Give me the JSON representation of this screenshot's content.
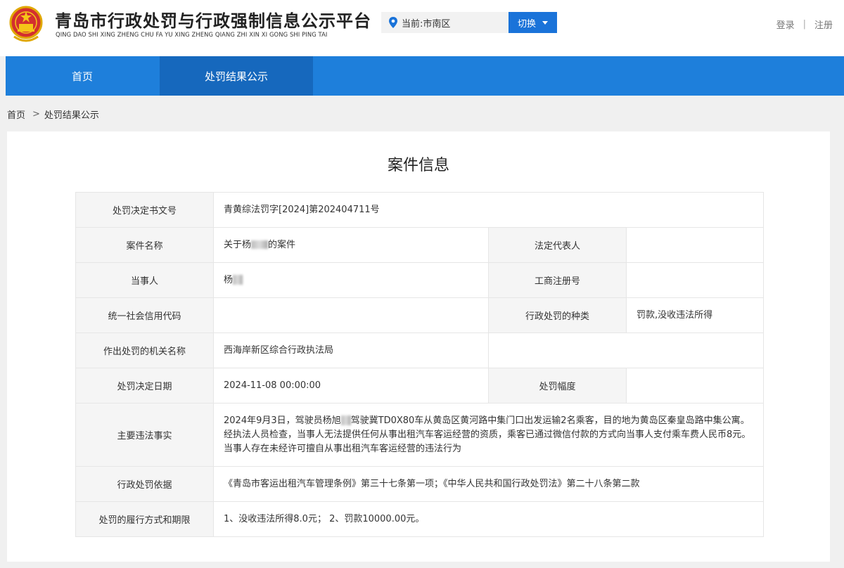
{
  "header": {
    "title": "青岛市行政处罚与行政强制信息公示平台",
    "pinyin": "QING DAO SHI XING ZHENG CHU FA YU XING ZHENG QIANG ZHI XIN XI GONG SHI PING TAI",
    "location_label": "当前:市南区",
    "switch_label": "切换",
    "login": "登录",
    "separator": "|",
    "register": "注册"
  },
  "nav": {
    "home": "首页",
    "results": "处罚结果公示"
  },
  "breadcrumb": {
    "home": "首页",
    "separator": ">",
    "current": "处罚结果公示"
  },
  "card": {
    "title": "案件信息",
    "rows": {
      "decision_no_label": "处罚决定书文号",
      "decision_no": "青黄综法罚字[2024]第202404711号",
      "case_name_label": "案件名称",
      "case_name_prefix": "关于杨",
      "case_name_suffix": "的案件",
      "legal_rep_label": "法定代表人",
      "legal_rep": "",
      "party_label": "当事人",
      "party": "杨",
      "reg_no_label": "工商注册号",
      "reg_no": "",
      "credit_code_label": "统一社会信用代码",
      "credit_code": "",
      "penalty_type_label": "行政处罚的种类",
      "penalty_type": "罚款,没收违法所得",
      "authority_label": "作出处罚的机关名称",
      "authority": "西海岸新区综合行政执法局",
      "date_label": "处罚决定日期",
      "date": "2024-11-08 00:00:00",
      "range_label": "处罚幅度",
      "range": "",
      "facts_label": "主要违法事实",
      "facts_part1": "2024年9月3日，驾驶员杨旭",
      "facts_part2": "驾驶冀TD0X80车从黄岛区黄河路中集门口出发运输2名乘客，目的地为黄岛区秦皇岛路中集公寓。经执法人员检查，当事人无法提供任何从事出租汽车客运经营的资质，乘客已通过微信付款的方式向当事人支付乘车费人民币8元。当事人存在未经许可擅自从事出租汽车客运经营的违法行为",
      "basis_label": "行政处罚依据",
      "basis": "《青岛市客运出租汽车管理条例》第三十七条第一项；《中华人民共和国行政处罚法》第二十八条第二款",
      "execution_label": "处罚的履行方式和期限",
      "execution": "1、没收违法所得8.0元； 2、罚款10000.00元。"
    }
  },
  "colors": {
    "nav": "#1e7fdb",
    "nav_active": "#1668bd",
    "button": "#1a73d9"
  },
  "icons": {
    "emblem": "national-emblem-icon",
    "location": "location-pin-icon",
    "dropdown": "caret-down-icon"
  }
}
